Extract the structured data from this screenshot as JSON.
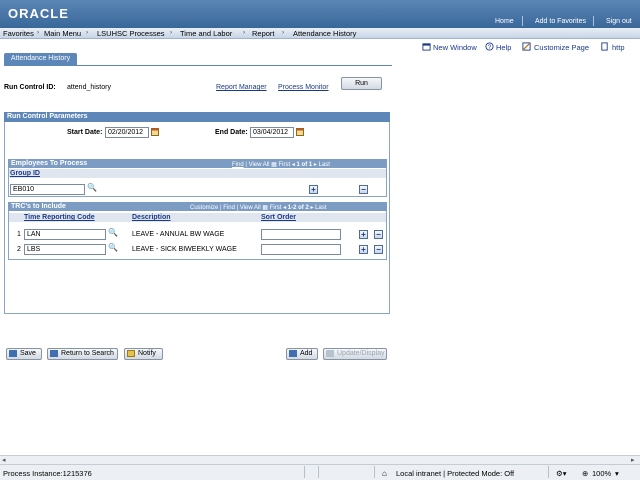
{
  "header": {
    "logo": "ORACLE",
    "links": [
      "Home",
      "Add to Favorites",
      "Sign out"
    ]
  },
  "menubar": {
    "items": [
      "Favorites",
      "Main Menu",
      "LSUHSC Processes",
      "Time and Labor",
      "Report",
      "Attendance History"
    ]
  },
  "toolbar": {
    "new_window": "New Window",
    "help": "Help",
    "customize": "Customize Page",
    "http": "http"
  },
  "tab": {
    "label": "Attendance History"
  },
  "run_control": {
    "label": "Run Control ID:",
    "value": "attend_history",
    "report_manager": "Report Manager",
    "process_monitor": "Process Monitor",
    "run_button": "Run"
  },
  "params": {
    "title": "Run Control Parameters",
    "start_label": "Start Date:",
    "start_value": "02/20/2012",
    "end_label": "End Date:",
    "end_value": "03/04/2012"
  },
  "employees_grid": {
    "title": "Employees To Process",
    "find": "Find",
    "view_all": "View All",
    "first": "First",
    "count": "1 of 1",
    "last": "Last",
    "column": "Group ID",
    "value": "EB010"
  },
  "trc_grid": {
    "title": "TRC's to Include",
    "customize": "Customize",
    "find": "Find",
    "view_all": "View All",
    "first": "First",
    "count": "1-2 of 2",
    "last": "Last",
    "columns": [
      "Time Reporting Code",
      "Description",
      "Sort Order"
    ],
    "rows": [
      {
        "num": "1",
        "code": "LAN",
        "desc": "LEAVE - ANNUAL BW  WAGE",
        "sort": ""
      },
      {
        "num": "2",
        "code": "LBS",
        "desc": "LEAVE - SICK BIWEEKLY WAGE",
        "sort": ""
      }
    ]
  },
  "buttons": {
    "save": "Save",
    "return": "Return to Search",
    "notify": "Notify",
    "add": "Add",
    "update": "Update/Display"
  },
  "statusbar": {
    "process_instance": "Process Instance:1215376",
    "zone": "Local intranet | Protected Mode: Off",
    "zoom": "100%"
  },
  "colors": {
    "header": "#3a679a",
    "section": "#5d87b8",
    "link": "#1c3a8a"
  }
}
